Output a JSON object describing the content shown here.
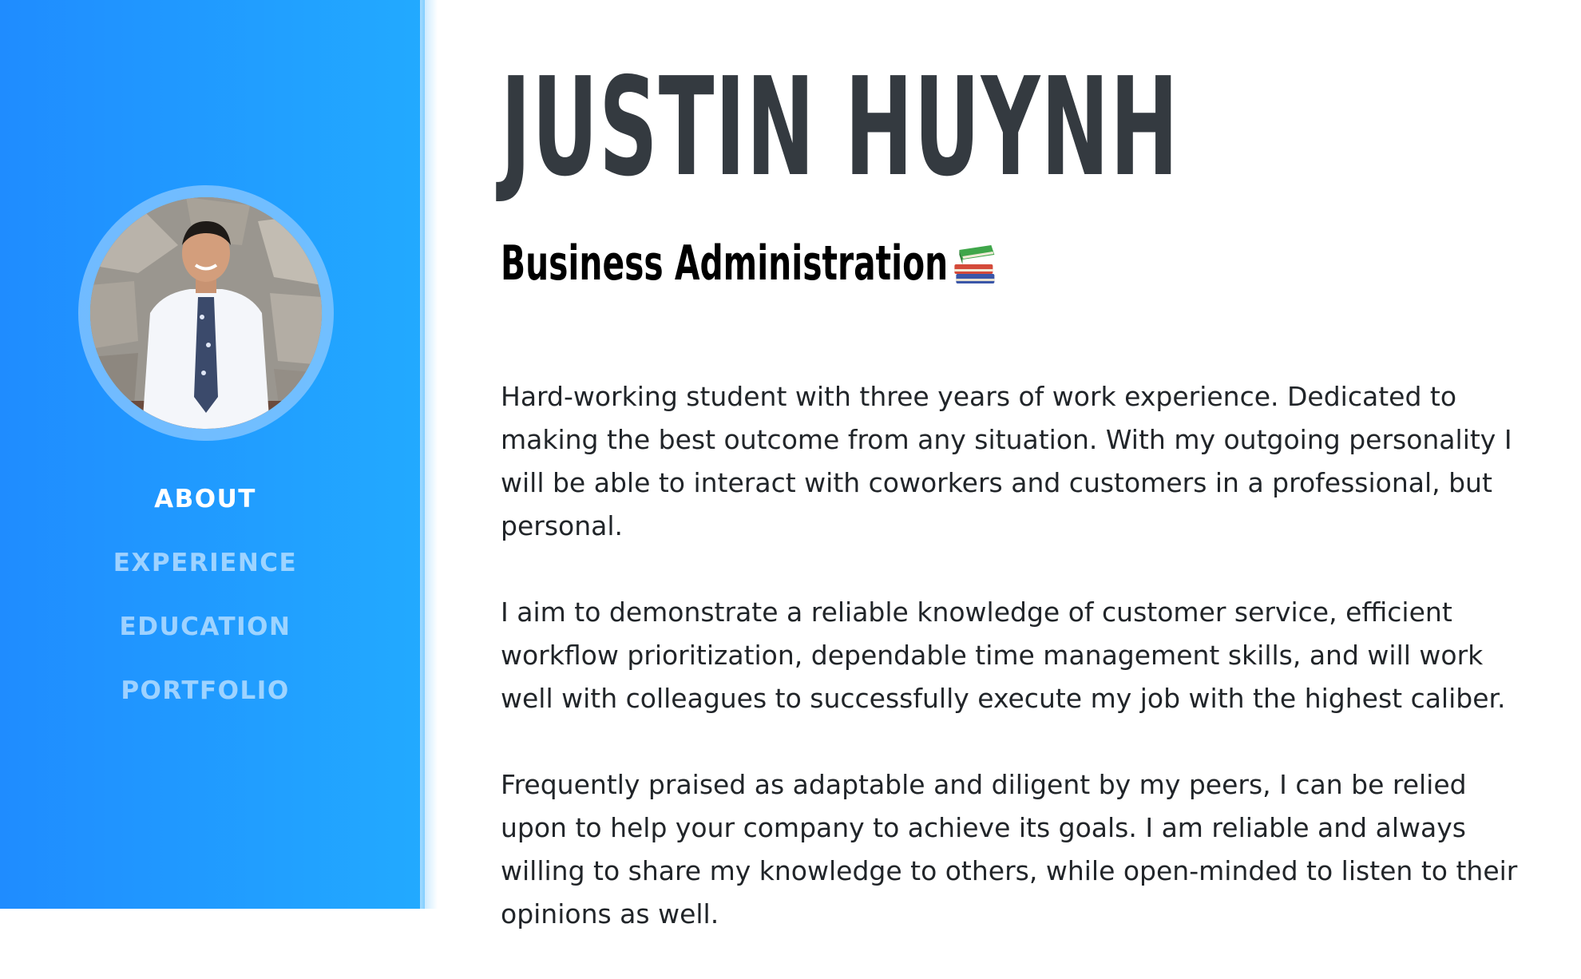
{
  "sidebar": {
    "avatar_alt": "profile photo",
    "nav": [
      {
        "label": "ABOUT",
        "active": true
      },
      {
        "label": "EXPERIENCE",
        "active": false
      },
      {
        "label": "EDUCATION",
        "active": false
      },
      {
        "label": "PORTFOLIO",
        "active": false
      }
    ]
  },
  "main": {
    "name": "JUSTIN HUYNH",
    "subtitle": "Business Administration",
    "subtitle_icon": "books-icon",
    "paragraphs": [
      "Hard-working student with three years of work experience. Dedicated to making the best outcome from any situation. With my outgoing personality I will be able to interact with coworkers and customers in a professional, but personal.",
      "I aim to demonstrate a reliable knowledge of customer service, efficient workflow prioritization, dependable time management skills, and will work well with colleagues to successfully execute my job with the highest caliber.",
      "Frequently praised as adaptable and diligent by my peers, I can be relied upon to help your company to achieve its goals. I am reliable and always willing to share my knowledge to others, while open-minded to listen to their opinions as well."
    ]
  },
  "colors": {
    "sidebar_start": "#1f8cff",
    "sidebar_end": "#22aaff",
    "heading": "#343a40",
    "nav_inactive": "#b9dcff",
    "nav_active": "#ffffff"
  }
}
